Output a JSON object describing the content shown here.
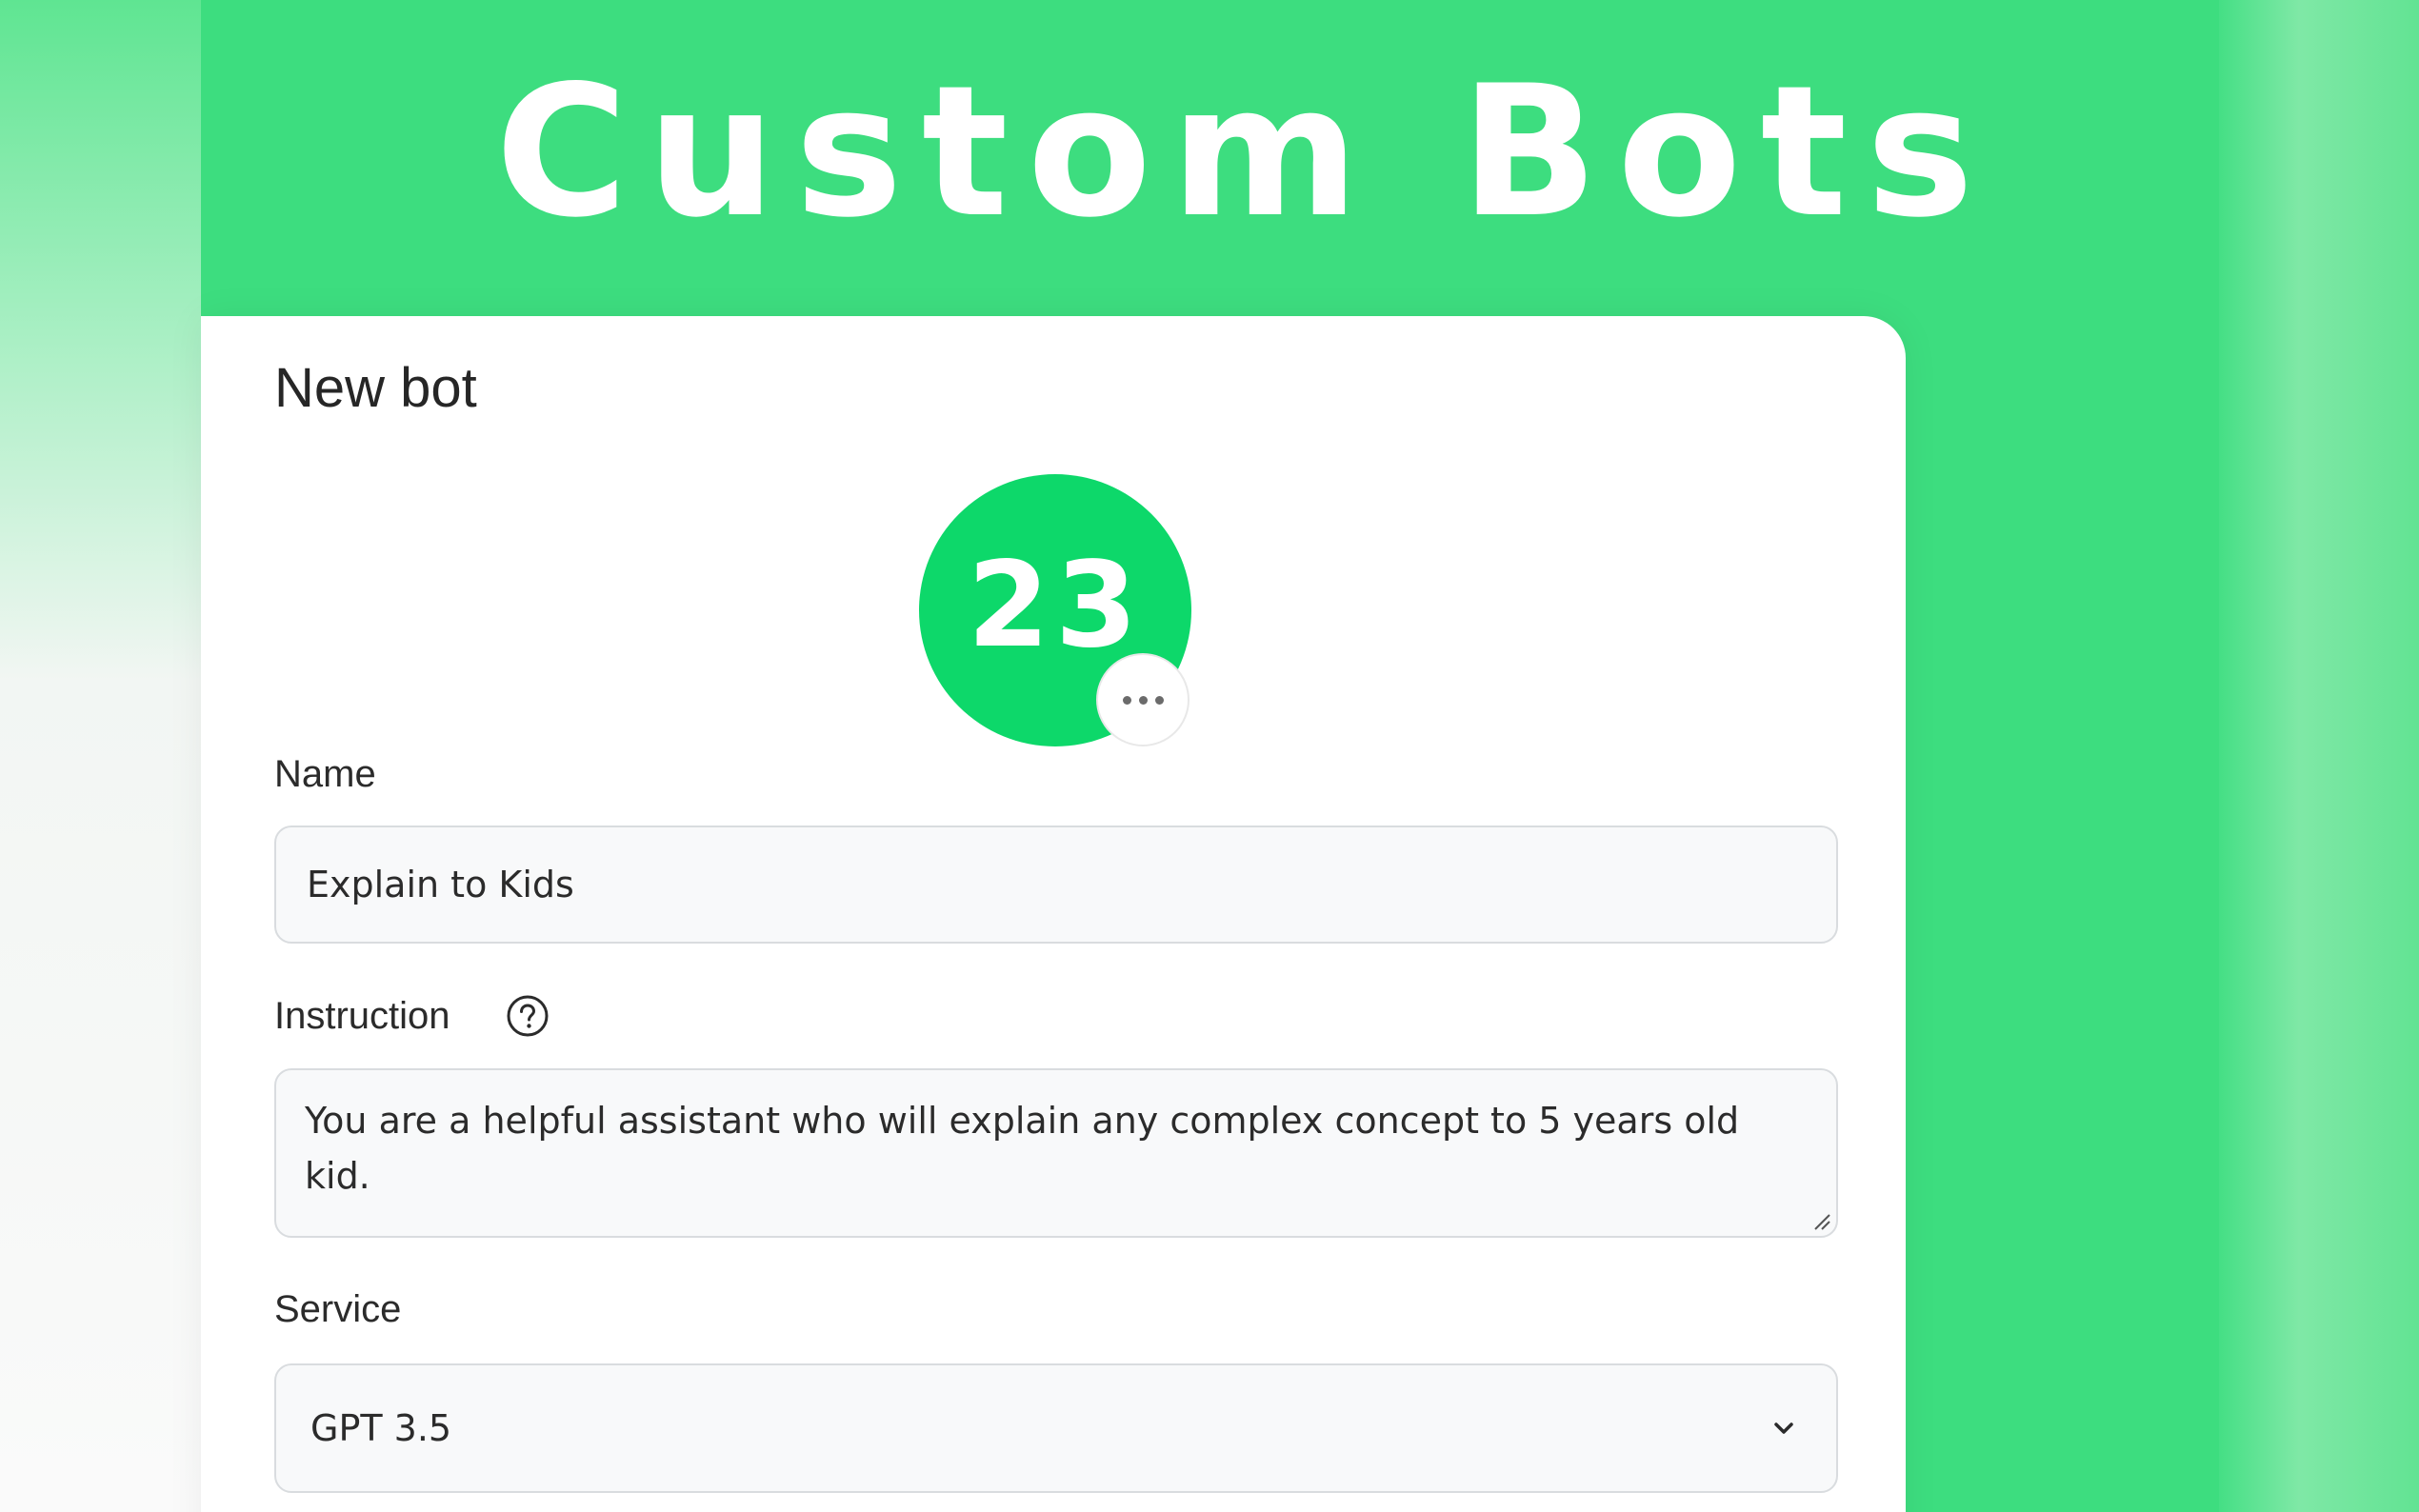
{
  "hero": {
    "title": "Custom Bots"
  },
  "card": {
    "title": "New bot"
  },
  "avatar": {
    "text": "23",
    "more_icon": "more-horizontal-icon"
  },
  "form": {
    "name": {
      "label": "Name",
      "value": "Explain to Kids"
    },
    "instruction": {
      "label": "Instruction",
      "help_icon": "question-circle-icon",
      "value": "You are a helpful assistant who will explain any complex concept to 5 years old kid."
    },
    "service": {
      "label": "Service",
      "value": "GPT 3.5",
      "dropdown_icon": "chevron-down-icon"
    }
  },
  "colors": {
    "background_green": "#3ddd7f",
    "avatar_green": "#0dd86a",
    "card": "#ffffff",
    "field_bg": "#f8f9fa",
    "field_border": "#d9dcdf",
    "text": "#2b2b2b"
  }
}
